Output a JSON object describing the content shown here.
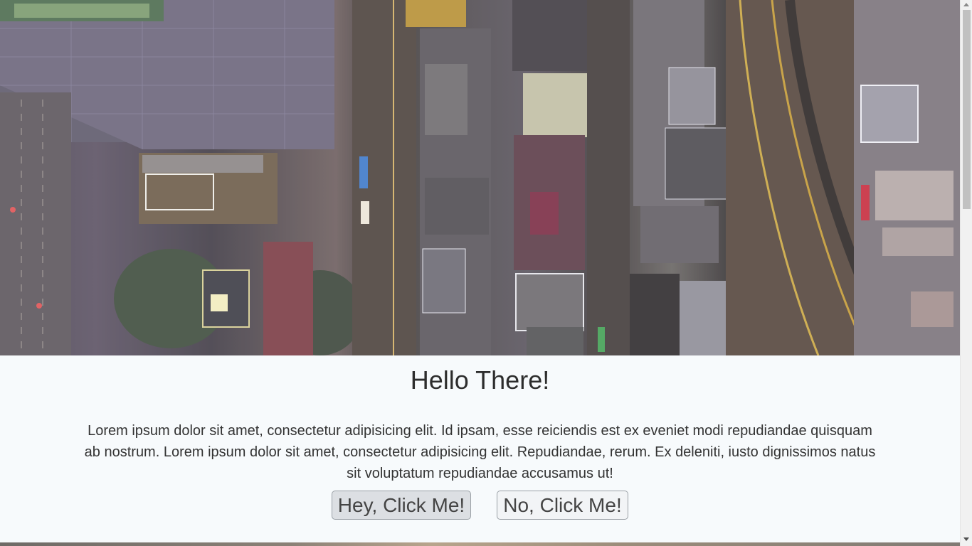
{
  "hero": {
    "image": "aerial-city-night-image"
  },
  "main": {
    "title": "Hello There!",
    "paragraph": "Lorem ipsum dolor sit amet, consectetur adipisicing elit. Id ipsam, esse reiciendis est ex eveniet modi repudiandae quisquam ab nostrum. Lorem ipsum dolor sit amet, consectetur adipisicing elit. Repudiandae, rerum. Ex deleniti, iusto dignissimos natus sit voluptatum repudiandae accusamus ut!",
    "buttons": [
      {
        "label": "Hey, Click Me!"
      },
      {
        "label": "No, Click Me!"
      }
    ]
  },
  "colors": {
    "page_background": "#f7fafc",
    "text": "#333333",
    "button_border": "#9aa0a6"
  }
}
